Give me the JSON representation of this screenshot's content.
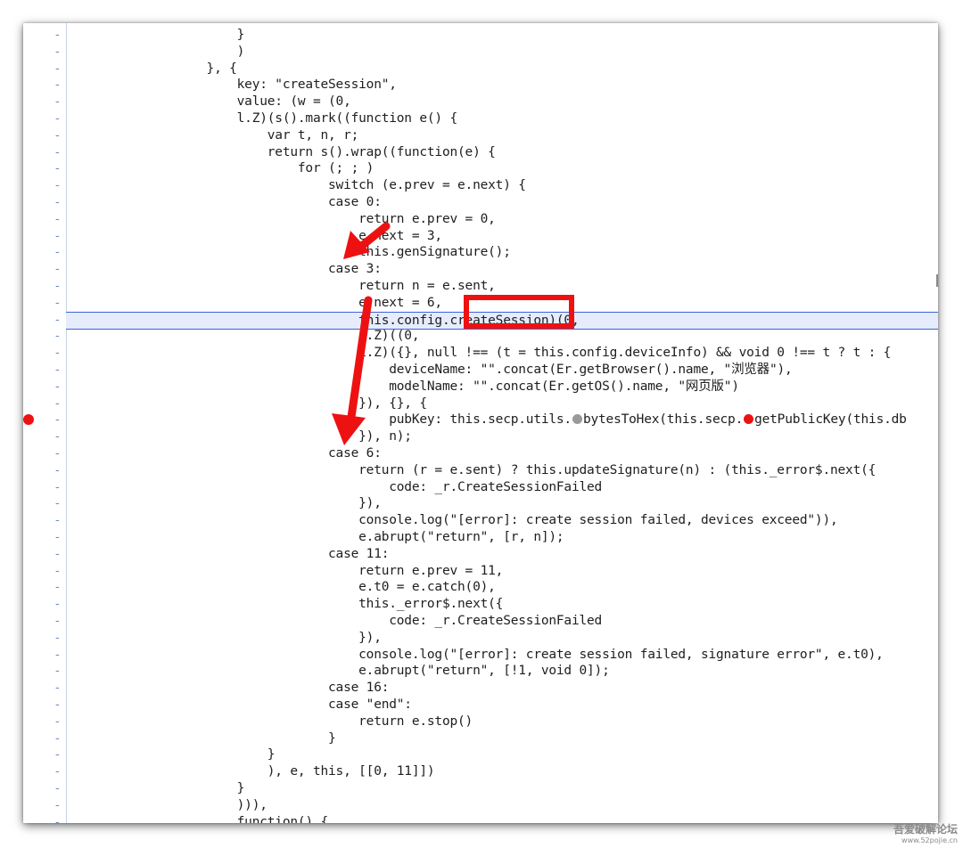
{
  "editor": {
    "gutter_marker": "-",
    "code_lines": [
      "                      }",
      "                      )",
      "                  }, {",
      "                      key: \"createSession\",",
      "                      value: (w = (0,",
      "                      l.Z)(s().mark((function e() {",
      "                          var t, n, r;",
      "                          return s().wrap((function(e) {",
      "                              for (; ; )",
      "                                  switch (e.prev = e.next) {",
      "                                  case 0:",
      "                                      return e.prev = 0,",
      "                                      e.next = 3,",
      "                                      this.genSignature();",
      "                                  case 3:",
      "                                      return n = e.sent,",
      "                                      e.next = 6,",
      "                                      this.config.createSession)(0,",
      "                                      i.Z)((0,",
      "                                      i.Z)({}, null !== (t = this.config.deviceInfo) && void 0 !== t ? t : {",
      "                                          deviceName: \"\".concat(Er.getBrowser().name, \"浏览器\"),",
      "                                          modelName: \"\".concat(Er.getOS().name, \"网页版\")",
      "                                      }), {}, {",
      "                                          pubKey: this.secp.utils.",
      "                                      }), n);",
      "                                  case 6:",
      "                                      return (r = e.sent) ? this.updateSignature(n) : (this._error$.next({",
      "                                          code: _r.CreateSessionFailed",
      "                                      }),",
      "                                      console.log(\"[error]: create session failed, devices exceed\")),",
      "                                      e.abrupt(\"return\", [r, n]);",
      "                                  case 11:",
      "                                      return e.prev = 11,",
      "                                      e.t0 = e.catch(0),",
      "                                      this._error$.next({",
      "                                          code: _r.CreateSessionFailed",
      "                                      }),",
      "                                      console.log(\"[error]: create session failed, signature error\", e.t0),",
      "                                      e.abrupt(\"return\", [!1, void 0]);",
      "                                  case 16:",
      "                                  case \"end\":",
      "                                      return e.stop()",
      "                                  }",
      "                          }",
      "                          ), e, this, [[0, 11]])",
      "                      }",
      "                      ))),",
      "                      function() {"
    ],
    "pubkey_line_parts": {
      "part_a": "                                          pubKey: this.secp.utils.",
      "part_b": "bytesToHex(this.secp.",
      "part_c": "getPublicKey(this.db"
    }
  },
  "watermark": {
    "line1": "吾爱破解论坛",
    "line2": "www.52pojie.cn"
  },
  "colors": {
    "annotation_red": "#ee1111",
    "gutter_marker": "#6c8cc4",
    "current_line_bg": "#e6ecfb",
    "current_line_border": "#3b64d8"
  }
}
